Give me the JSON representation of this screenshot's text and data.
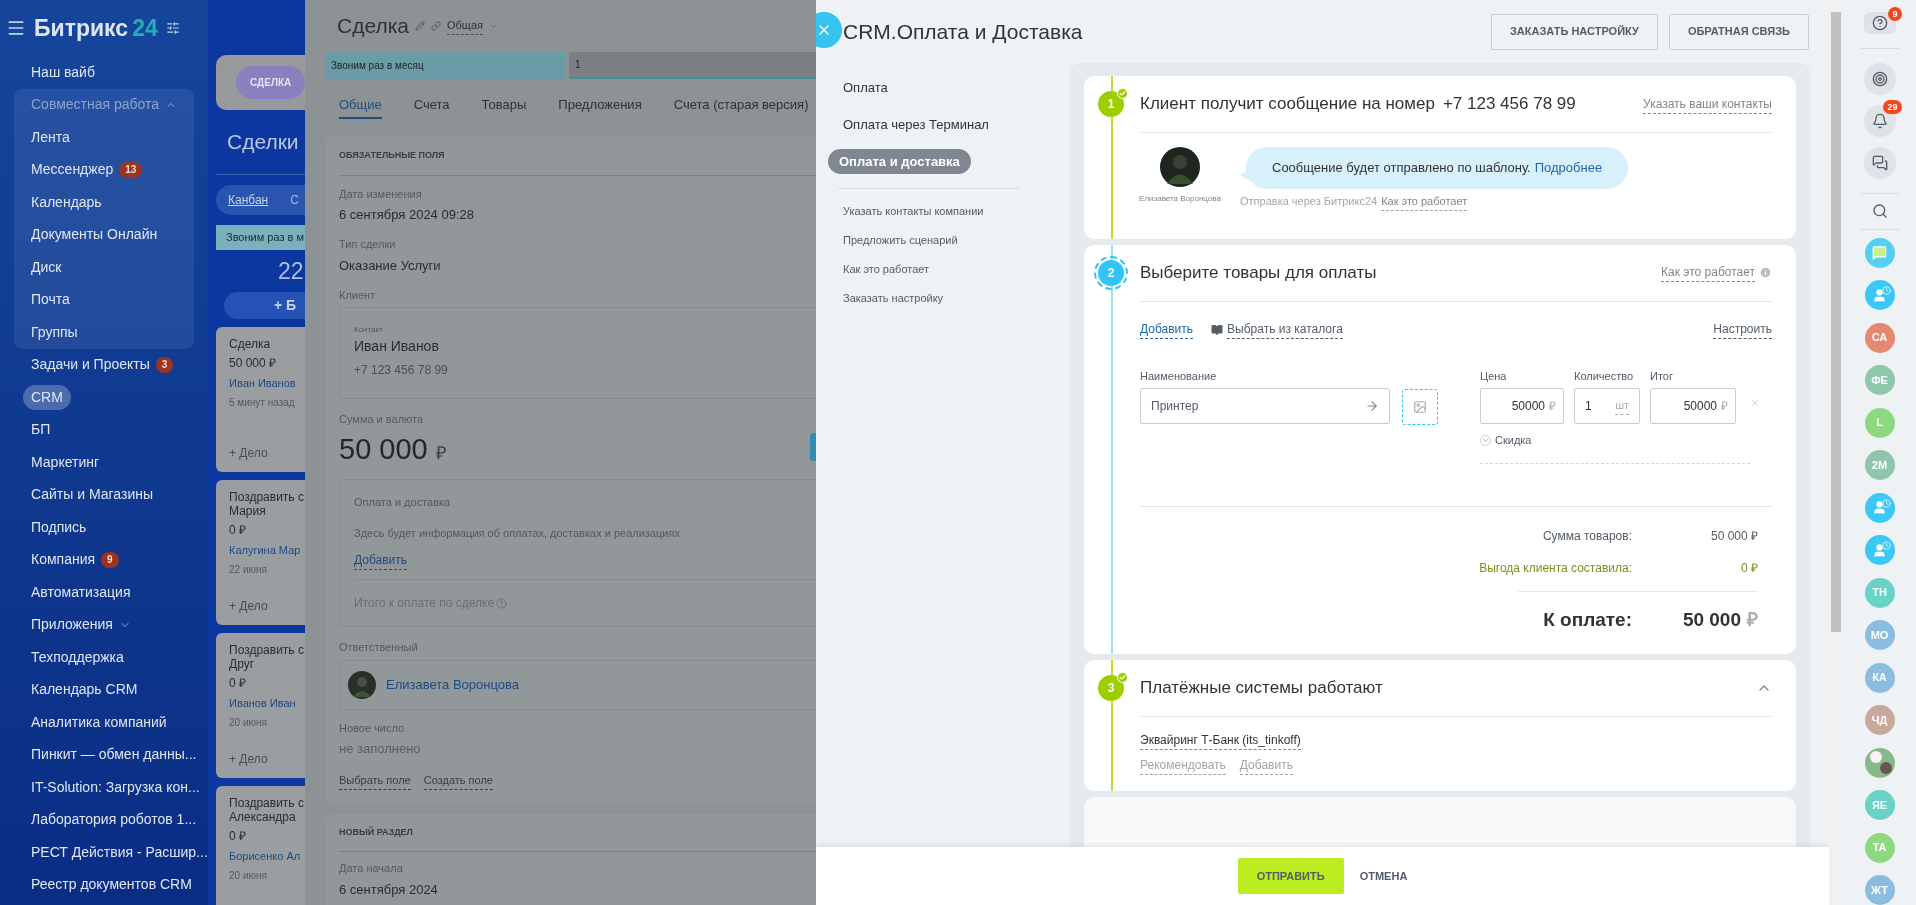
{
  "sidebar": {
    "logo": "Битрикс",
    "logo_number": "24",
    "items": [
      {
        "label": "Наш вайб",
        "selected": false
      },
      {
        "label": "Совместная работа",
        "selected": false,
        "expanded": true,
        "children": [
          {
            "label": "Лента",
            "selected": false
          },
          {
            "label": "Мессенджер",
            "selected": false,
            "badge": "13"
          },
          {
            "label": "Календарь",
            "selected": false
          },
          {
            "label": "Документы Онлайн",
            "selected": false
          },
          {
            "label": "Диск",
            "selected": false
          },
          {
            "label": "Почта",
            "selected": false
          },
          {
            "label": "Группы",
            "selected": false
          }
        ]
      },
      {
        "label": "Задачи и Проекты",
        "selected": false,
        "badge": "3"
      },
      {
        "label": "CRM",
        "selected": true
      },
      {
        "label": "БП",
        "selected": false
      },
      {
        "label": "Маркетинг",
        "selected": false
      },
      {
        "label": "Сайты и Магазины",
        "selected": false
      },
      {
        "label": "Подпись",
        "selected": false
      },
      {
        "label": "Компания",
        "selected": false,
        "badge": "9"
      },
      {
        "label": "Автоматизация",
        "selected": false
      },
      {
        "label": "Приложения",
        "selected": false,
        "expanded": false
      },
      {
        "label": "Техподдержка",
        "selected": false
      },
      {
        "label": "Календарь CRM",
        "selected": false
      },
      {
        "label": "Аналитика компаний",
        "selected": false
      },
      {
        "label": "Пинкит — обмен данны...",
        "selected": false
      },
      {
        "label": "IT-Solution: Загрузка кон...",
        "selected": false
      },
      {
        "label": "Лаборатория роботов 1...",
        "selected": false
      },
      {
        "label": "РЕСТ Действия - Расшир...",
        "selected": false
      },
      {
        "label": "Реестр документов CRM",
        "selected": false
      }
    ]
  },
  "kanban": {
    "tag": "СДЕЛКА",
    "title": "Сделки",
    "views": [
      {
        "label": "Канбан",
        "selected": true
      },
      {
        "label": "С",
        "selected": false
      }
    ],
    "column": {
      "title": "Звоним раз в м",
      "count": "22",
      "add_label": "+ Б"
    },
    "cards": [
      {
        "title": "Сделка",
        "amount": "50 000 ₽",
        "contact": "Иван Иванов",
        "date": "5 минут назад",
        "action": "+ Дело"
      },
      {
        "title": "Поздравить с\nМария",
        "amount": "0 ₽",
        "contact": "Калугина Мар",
        "date": "22 июня",
        "action": "+ Дело"
      },
      {
        "title": "Поздравить с\nДруг",
        "amount": "0 ₽",
        "contact": "Иванов Иван",
        "date": "20 июня",
        "action": "+ Дело"
      },
      {
        "title": "Поздравить с\nАлександра",
        "amount": "0 ₽",
        "contact": "Борисенко Ал",
        "date": "20 июня"
      }
    ]
  },
  "deal": {
    "title": "Сделка",
    "category": "Общая",
    "stages": [
      {
        "label": "Звоним раз в месяц",
        "selected": true
      },
      {
        "label": "1",
        "selected": false
      }
    ],
    "tabs": [
      {
        "label": "Общие",
        "selected": true
      },
      {
        "label": "Счета",
        "selected": false
      },
      {
        "label": "Товары",
        "selected": false
      },
      {
        "label": "Предложения",
        "selected": false
      },
      {
        "label": "Счета (старая версия)",
        "selected": false
      }
    ],
    "required_section": {
      "heading": "ОБЯЗАТЕЛЬНЫЕ ПОЛЯ",
      "fields": [
        {
          "label": "Дата изменения",
          "value": "6 сентября 2024 09:28"
        },
        {
          "label": "Тип сделки",
          "value": "Оказание Услуги"
        }
      ],
      "client": {
        "label": "Клиент",
        "role": "Контакт",
        "name": "Иван Иванов",
        "phone": "+7 123 456 78 99"
      },
      "amount": {
        "label": "Сумма и валюта",
        "value": "50 000",
        "currency": "₽"
      },
      "payment": {
        "title": "Оплата и доставка",
        "text": "Здесь будет информация об оплатах, доставках и реализациях",
        "add": "Добавить",
        "total_label": "Итого к оплате по сделке"
      },
      "responsible": {
        "label": "Ответственный",
        "name": "Елизавета Воронцова"
      },
      "custom_field": {
        "label": "Новое число",
        "value": "не заполнено"
      },
      "links": [
        "Выбрать поле",
        "Создать поле"
      ]
    },
    "new_section": {
      "heading": "НОВЫЙ РАЗДЕЛ",
      "field_label": "Дата начала",
      "field_value": "6 сентября 2024"
    }
  },
  "payment_slider": {
    "title": "CRM.Оплата и Доставка",
    "header_buttons": [
      "ЗАКАЗАТЬ НАСТРОЙКУ",
      "ОБРАТНАЯ СВЯЗЬ"
    ],
    "menu": [
      {
        "label": "Оплата",
        "selected": false
      },
      {
        "label": "Оплата через Терминал",
        "selected": false
      },
      {
        "label": "Оплата и доставка",
        "selected": true
      }
    ],
    "menu_links": [
      "Указать контакты компании",
      "Предложить сценарий",
      "Как это работает",
      "Заказать настройку"
    ],
    "steps": [
      {
        "number": "1",
        "done": true,
        "title": "Клиент получит сообщение на номер",
        "phone": "+7 123 456 78 99",
        "link": "Указать ваши контакты",
        "sender": "Елизавета Воронцова",
        "message": "Сообщение будет отправлено по шаблону.",
        "message_link": "Подробнее",
        "via": "Отправка через Битрикс24",
        "via_link": "Как это работает"
      },
      {
        "number": "2",
        "done": false,
        "title": "Выберите товары для оплаты",
        "link": "Как это работает",
        "actions": [
          "Добавить",
          "Выбрать из каталога"
        ],
        "settings": "Настроить",
        "columns": [
          "Наименование",
          "Цена",
          "Количество",
          "Итог"
        ],
        "product": {
          "name": "Принтер",
          "price": "50000",
          "currency": "₽",
          "quantity": "1",
          "unit": "шт",
          "total": "50000",
          "total_currency": "₽",
          "discount": "Скидка"
        },
        "totals": [
          {
            "label": "Сумма товаров:",
            "value": "50 000 ₽",
            "kind": "plain"
          },
          {
            "label": "Выгода клиента составила:",
            "value": "0 ₽",
            "kind": "benefit"
          }
        ],
        "grand_label": "К оплате:",
        "grand_value": "50 000",
        "grand_currency": "₽"
      },
      {
        "number": "3",
        "done": true,
        "title": "Платёжные системы работают",
        "expanded": true,
        "system": "Эквайринг Т-Банк (its_tinkoff)",
        "system_links": [
          "Рекомендовать",
          "Добавить"
        ]
      }
    ],
    "footer_buttons": [
      "ОТПРАВИТЬ",
      "ОТМЕНА"
    ]
  },
  "right_bar": {
    "tools": [
      {
        "kind": "help",
        "badge": "9"
      },
      {
        "kind": "target"
      },
      {
        "kind": "bell",
        "badge": "29"
      },
      {
        "kind": "chat"
      },
      {
        "kind": "search"
      }
    ],
    "contacts": [
      {
        "kind": "chat"
      },
      {
        "kind": "user"
      },
      {
        "kind": "initials",
        "initials": "СА",
        "color": "#e5886f"
      },
      {
        "kind": "initials",
        "initials": "ФЕ",
        "color": "#8ec7aa"
      },
      {
        "kind": "initials",
        "initials": "L",
        "color": "#8ed882"
      },
      {
        "kind": "initials",
        "initials": "2М",
        "color": "#8fc4ad"
      },
      {
        "kind": "user"
      },
      {
        "kind": "user"
      },
      {
        "kind": "initials",
        "initials": "ТН",
        "color": "#6ad3c8"
      },
      {
        "kind": "initials",
        "initials": "МО",
        "color": "#8bbde0"
      },
      {
        "kind": "initials",
        "initials": "КА",
        "color": "#8bbde0"
      },
      {
        "kind": "initials",
        "initials": "ЧД",
        "color": "#c8a99b"
      },
      {
        "kind": "avatar"
      },
      {
        "kind": "initials",
        "initials": "ЯЕ",
        "color": "#6ad3c8"
      },
      {
        "kind": "initials",
        "initials": "ТА",
        "color": "#8ed882"
      },
      {
        "kind": "initials",
        "initials": "ЖТ",
        "color": "#8bbde0"
      }
    ]
  }
}
